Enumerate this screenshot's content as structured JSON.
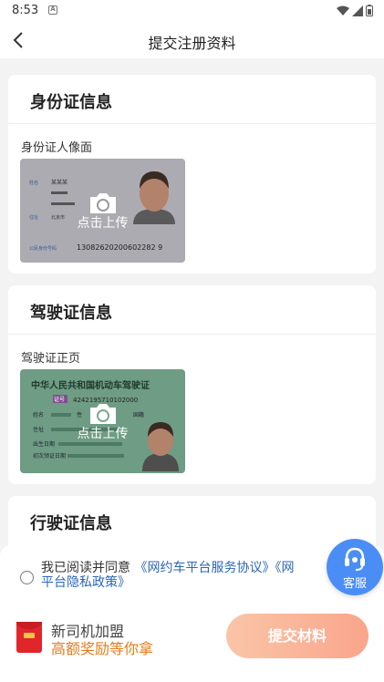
{
  "status_bar": {
    "time": "8:53",
    "app_icon": "A"
  },
  "header": {
    "title": "提交注册资料",
    "back_icon": "chevron-left-icon"
  },
  "id_card_section": {
    "title": "身份证信息",
    "field_label": "身份证人像面",
    "sample": {
      "name_label": "姓名",
      "name_value": "某某某",
      "address_label": "住址",
      "address_value": "北京市",
      "id_label": "公民身份号码",
      "id_number": "13082620200602282 9"
    },
    "upload_text": "点击上传"
  },
  "license_section": {
    "title": "驾驶证信息",
    "field_label": "驾驶证正页",
    "sample": {
      "heading": "中华人民共和国机动车驾驶证",
      "number_label": "证号",
      "number_value": "4242195710102000",
      "name_label": "姓名",
      "sex_label": "性",
      "nationality_label": "国籍",
      "address_label": "住址",
      "birth_label": "出生日期",
      "first_issue_label": "初次领证日期"
    },
    "upload_text": "点击上传"
  },
  "vehicle_section": {
    "title": "行驶证信息"
  },
  "agreement": {
    "prefix": "我已阅读并同意 ",
    "link1": "《网约车平台服务协议》",
    "link2_start": "《网",
    "link2_end": "平台隐私政策》"
  },
  "customer_service": {
    "label": "客服",
    "icon": "headset-icon"
  },
  "promo": {
    "line1": "新司机加盟",
    "line2": "高额奖励等你拿"
  },
  "submit_button": {
    "label": "提交材料"
  },
  "colors": {
    "accent_link": "#2b66b8",
    "promo_orange": "#e77a1a",
    "submit_gradient_start": "#fbc5a8",
    "submit_gradient_end": "#f9a58b",
    "service_blue": "#4a8ef5"
  }
}
